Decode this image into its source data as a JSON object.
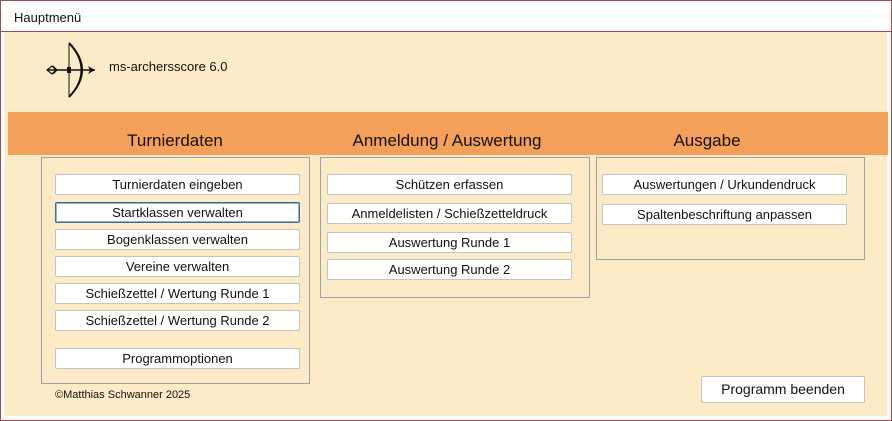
{
  "window": {
    "title": "Hauptmenü"
  },
  "app": {
    "name": "ms-archersscore 6.0",
    "logo_icon": "bow-and-arrow-icon"
  },
  "sections": {
    "turnierdaten": {
      "title": "Turnierdaten",
      "buttons": [
        "Turnierdaten eingeben",
        "Startklassen verwalten",
        "Bogenklassen verwalten",
        "Vereine verwalten",
        "Schießzettel / Wertung  Runde 1",
        "Schießzettel / Wertung  Runde 2",
        "Programmoptionen"
      ]
    },
    "anmeldung": {
      "title": "Anmeldung / Auswertung",
      "buttons": [
        "Schützen erfassen",
        "Anmeldelisten / Schießzetteldruck",
        "Auswertung Runde 1",
        "Auswertung Runde 2"
      ]
    },
    "ausgabe": {
      "title": "Ausgabe",
      "buttons": [
        "Auswertungen / Urkundendruck",
        "Spaltenbeschriftung anpassen"
      ]
    }
  },
  "footer": {
    "copyright": "©Matthias Schwanner 2025",
    "exit_label": "Programm beenden"
  },
  "colors": {
    "background": "#fdebc8",
    "header_band": "#f5a05a",
    "window_border": "#a14a52",
    "focus_border": "#3a6f8f"
  }
}
